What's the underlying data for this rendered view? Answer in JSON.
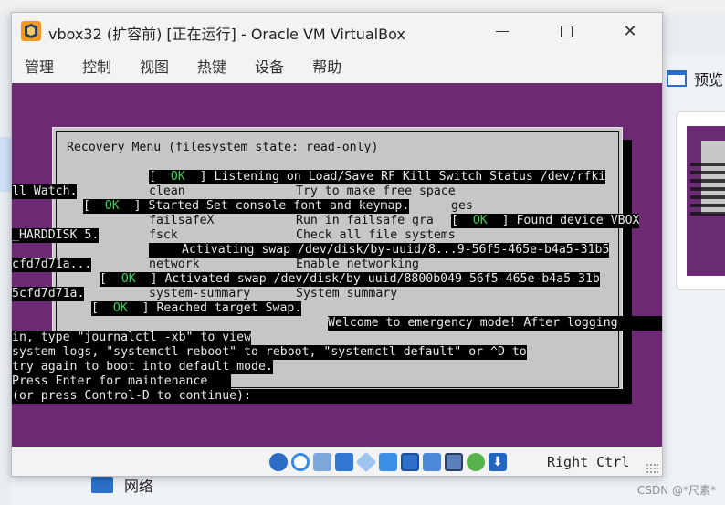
{
  "window": {
    "title": "vbox32 (扩容前) [正在运行] - Oracle VM VirtualBox",
    "controls": {
      "minimize": "—",
      "maximize": "",
      "close": "✕"
    }
  },
  "menubar": [
    "管理",
    "控制",
    "视图",
    "热键",
    "设备",
    "帮助"
  ],
  "recovery_menu": {
    "title": "Recovery Menu (filesystem state: read-only)",
    "options": [
      {
        "key": "clean",
        "desc": "Try to make free space"
      },
      {
        "key": "failsafeX",
        "desc": "Run in failsafe gra"
      },
      {
        "key": "fsck",
        "desc": "Check all file systems"
      },
      {
        "key": "network",
        "desc": "Enable networking"
      },
      {
        "key": "system-summary",
        "desc": "System summary"
      }
    ]
  },
  "boot_messages": {
    "ok_label": "OK",
    "listening": "[  OK  ] Listening on Load/Save RF Kill Switch Status /dev/rfki",
    "watch": "ll Watch.",
    "started_prefix": "[  OK  ] Started Set console font and keymap.",
    "started_tail": "ges",
    "found": "[  OK  ] Found device VBOX",
    "harddisk": "_HARDDISK 5.",
    "activating": "Activating swap /dev/disk/by-uuid/8...9-56f5-465e-b4a5-31b5",
    "cfd": "cfd7d71a...",
    "activated": "[  OK  ] Activated swap /dev/disk/by-uuid/8800b049-56f5-465e-b4a5-31b",
    "cfd2": "5cfd7d71a.",
    "reached": "[  OK  ] Reached target Swap.",
    "welcome": "Welcome to emergency mode! After logging",
    "line1": "in, type \"journalctl -xb\" to view",
    "line2": "system logs, \"systemctl reboot\" to reboot, \"systemctl default\" or ^D to",
    "line3": "try again to boot into default mode.",
    "line4": "Press Enter for maintenance",
    "line5": "(or press Control-D to continue):"
  },
  "statusbar": {
    "host_key": "Right Ctrl",
    "icons": [
      "optical-drive-icon",
      "disk-icon",
      "audio-icon",
      "network-icon",
      "usb-icon",
      "shared-folder-icon",
      "display-icon",
      "recording-icon",
      "cpu-icon",
      "mouse-integration-icon",
      "keyboard-icon"
    ]
  },
  "desktop": {
    "preview_label": "预览",
    "network_label": "网络",
    "watermark": "CSDN @*尺素*"
  }
}
